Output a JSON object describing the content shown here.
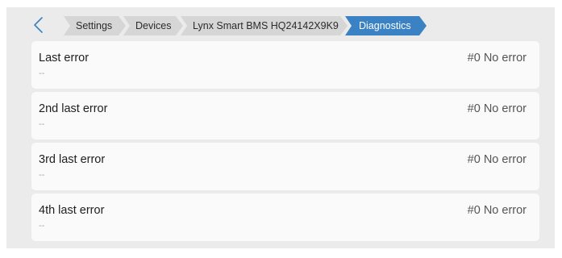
{
  "breadcrumb": {
    "back_icon": "chevron-left-icon",
    "items": [
      {
        "label": "Settings"
      },
      {
        "label": "Devices"
      },
      {
        "label": "Lynx Smart BMS HQ24142X9K9"
      },
      {
        "label": "Diagnostics"
      }
    ],
    "accent_color": "#3b82c4",
    "inactive_color": "#d6d6d6"
  },
  "errors": [
    {
      "title": "Last error",
      "subtitle": "--",
      "value": "#0 No error"
    },
    {
      "title": "2nd last error",
      "subtitle": "--",
      "value": "#0 No error"
    },
    {
      "title": "3rd last error",
      "subtitle": "--",
      "value": "#0 No error"
    },
    {
      "title": "4th last error",
      "subtitle": "--",
      "value": "#0 No error"
    }
  ]
}
